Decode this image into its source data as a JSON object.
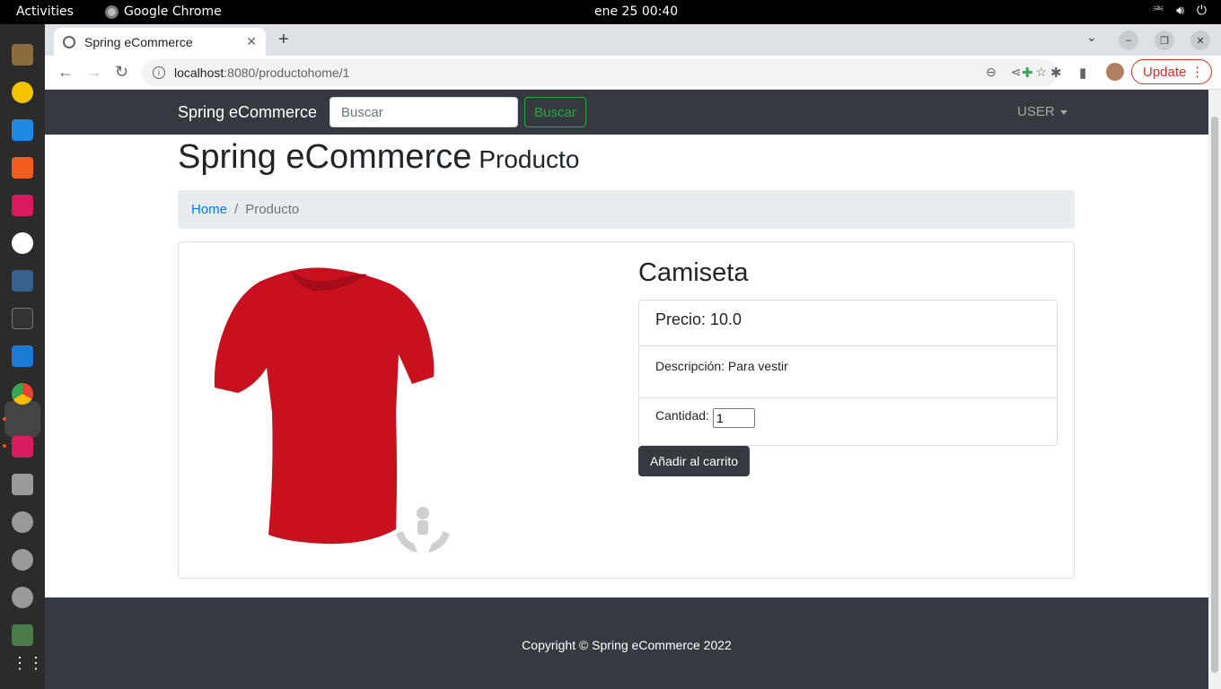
{
  "system": {
    "activities": "Activities",
    "app_name": "Google Chrome",
    "clock": "ene 25  00:40"
  },
  "browser": {
    "tab_title": "Spring eCommerce",
    "url_host": "localhost",
    "url_path": ":8080/productohome/1",
    "update_label": "Update"
  },
  "navbar": {
    "brand": "Spring eCommerce",
    "search_placeholder": "Buscar",
    "search_button": "Buscar",
    "user_menu": "USER"
  },
  "heading": {
    "title": "Spring eCommerce",
    "subtitle": "Producto"
  },
  "breadcrumb": {
    "home": "Home",
    "separator": "/",
    "current": "Producto"
  },
  "product": {
    "name": "Camiseta",
    "price": "Precio: 10.0",
    "description": "Descripción: Para vestir",
    "quantity_label": "Cantidad:",
    "quantity_value": "1",
    "add_to_cart": "Añadir al carrito",
    "image_color": "#c8101e"
  },
  "footer": {
    "copyright": "Copyright © Spring eCommerce 2022"
  },
  "dock": {
    "icons": [
      "files-icon",
      "rhythmbox-icon",
      "writer-icon",
      "software-icon",
      "intellij-icon",
      "writer-web-icon",
      "mysql-workbench-icon",
      "terminal-icon",
      "vscode-icon",
      "chrome-icon",
      "intellij-icon-2",
      "usb-icon",
      "disk-icon",
      "disk-icon-2",
      "disk-icon-3",
      "trash-icon",
      "apps-grid-icon"
    ]
  }
}
